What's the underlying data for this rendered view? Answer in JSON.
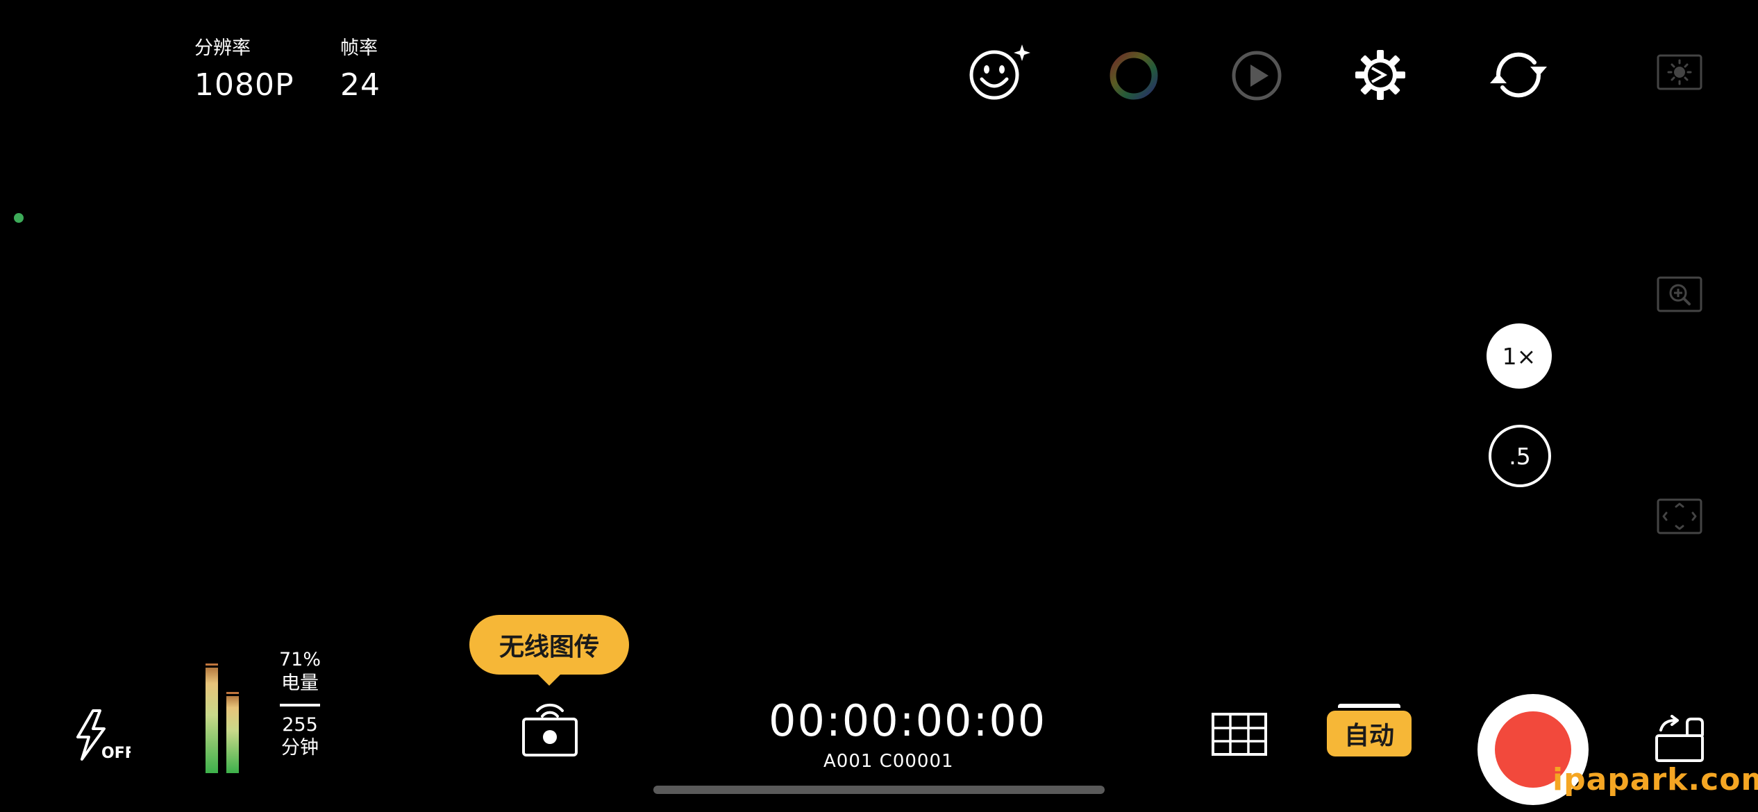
{
  "top_info": {
    "resolution_label": "分辨率",
    "resolution_value": "1080P",
    "framerate_label": "帧率",
    "framerate_value": "24"
  },
  "top_bar_icons": [
    "beauty-smiley-icon",
    "color-wheel-icon",
    "playback-icon",
    "settings-gear-icon",
    "switch-camera-icon"
  ],
  "right_rail_icons": [
    "exposure-icon",
    "zoom-in-icon",
    "frame-expand-icon"
  ],
  "zoom": {
    "selected": "1×",
    "options": [
      "1×",
      ".5"
    ]
  },
  "tooltip": {
    "text": "无线图传"
  },
  "bottom_bar": {
    "flash_label": "OFF",
    "battery_percent": "71%",
    "battery_label": "电量",
    "remaining_value": "255",
    "remaining_label": "分钟",
    "timecode": "00:00:00:00",
    "clip_id": "A001 C00001",
    "auto_label": "自动"
  },
  "audio_meter": {
    "left_level": 0.96,
    "right_level": 0.7
  },
  "colors": {
    "accent_yellow": "#f6b737",
    "record_red": "#f2493c",
    "status_green": "#3dab59",
    "watermark_orange": "#f5a623"
  },
  "watermark": "ipapark.com"
}
